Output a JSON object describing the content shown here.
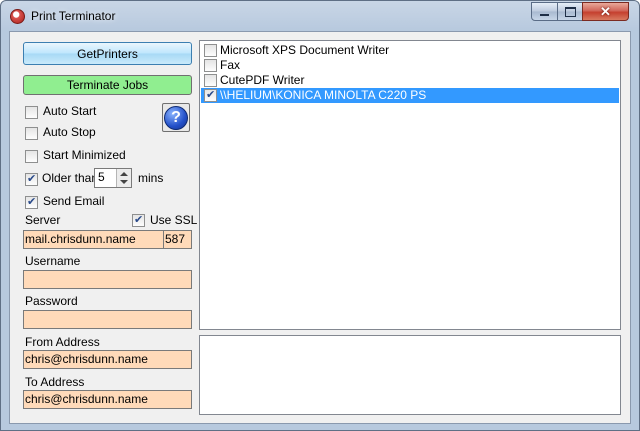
{
  "window": {
    "title": "Print Terminator",
    "icons": {
      "app": "printer-app-icon",
      "minimize": "minimize-icon",
      "maximize": "maximize-icon",
      "close": "close-icon"
    },
    "close_glyph": "✕"
  },
  "buttons": {
    "get_printers": "GetPrinters",
    "terminate_jobs": "Terminate Jobs",
    "help_glyph": "?"
  },
  "options": {
    "auto_start": {
      "label": "Auto Start",
      "checked": false
    },
    "auto_stop": {
      "label": "Auto Stop",
      "checked": false
    },
    "start_minimized": {
      "label": "Start Minimized",
      "checked": false
    },
    "older_than": {
      "label": "Older than",
      "checked": true,
      "value": "5",
      "unit": "mins"
    },
    "send_email": {
      "label": "Send Email",
      "checked": true
    }
  },
  "email": {
    "server_label": "Server",
    "use_ssl_label": "Use SSL",
    "use_ssl_checked": true,
    "server_value": "mail.chrisdunn.name",
    "port_value": "587",
    "username_label": "Username",
    "username_value": "",
    "password_label": "Password",
    "password_value": "",
    "from_label": "From Address",
    "from_value": "chris@chrisdunn.name",
    "to_label": "To Address",
    "to_value": "chris@chrisdunn.name"
  },
  "printers": [
    {
      "name": "Microsoft XPS Document Writer",
      "checked": false,
      "selected": false
    },
    {
      "name": "Fax",
      "checked": false,
      "selected": false
    },
    {
      "name": "CutePDF Writer",
      "checked": false,
      "selected": false
    },
    {
      "name": "\\\\HELIUM\\KONICA MINOLTA C220 PS",
      "checked": true,
      "selected": true
    }
  ],
  "log": {
    "text": ""
  },
  "colors": {
    "input_bg": "#ffdab9",
    "terminate_bg": "#90ee90",
    "selection": "#3399ff"
  }
}
